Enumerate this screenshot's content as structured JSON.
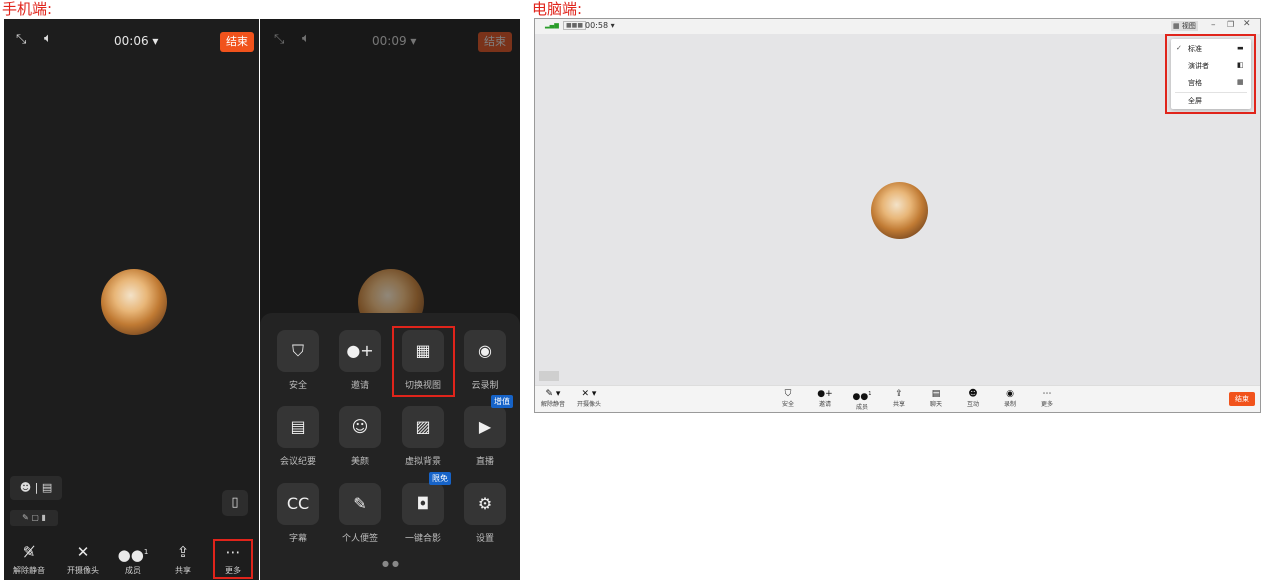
{
  "captions": {
    "phone": "手机端:",
    "desktop": "电脑端:"
  },
  "phone1": {
    "timer": "00:06 ▾",
    "end_label": "结束",
    "bottom_bar": [
      {
        "label": "解除静音",
        "icon": "mic-muted-icon"
      },
      {
        "label": "开摄像头",
        "icon": "camera-off-icon"
      },
      {
        "label": "成员",
        "icon": "members-icon",
        "count": "1"
      },
      {
        "label": "共享",
        "icon": "share-icon"
      },
      {
        "label": "更多",
        "icon": "more-icon"
      }
    ]
  },
  "phone2": {
    "timer": "00:09 ▾",
    "end_label": "结束",
    "more_menu": [
      {
        "label": "安全",
        "icon": "shield-icon"
      },
      {
        "label": "邀请",
        "icon": "invite-icon"
      },
      {
        "label": "切换视图",
        "icon": "switch-view-icon"
      },
      {
        "label": "云录制",
        "icon": "cloud-record-icon"
      },
      {
        "label": "会议纪要",
        "icon": "minutes-icon"
      },
      {
        "label": "美颜",
        "icon": "beauty-icon"
      },
      {
        "label": "虚拟背景",
        "icon": "virtual-bg-icon"
      },
      {
        "label": "直播",
        "icon": "live-icon",
        "badge": "增值"
      },
      {
        "label": "字幕",
        "icon": "caption-icon"
      },
      {
        "label": "个人便签",
        "icon": "note-icon"
      },
      {
        "label": "一键合影",
        "icon": "group-photo-icon",
        "badge": "限免"
      },
      {
        "label": "设置",
        "icon": "settings-icon"
      }
    ]
  },
  "desktop": {
    "timer": "00:58 ▾",
    "view_button": "视图",
    "view_menu": [
      {
        "label": "标准",
        "checked": true
      },
      {
        "label": "演讲者",
        "checked": false
      },
      {
        "label": "宫格",
        "checked": false
      },
      {
        "label": "全屏",
        "checked": false
      }
    ],
    "left_controls": [
      {
        "label": "解除静音",
        "icon": "mic-muted-icon"
      },
      {
        "label": "开摄像头",
        "icon": "camera-off-icon"
      }
    ],
    "toolbar": [
      {
        "label": "安全",
        "icon": "shield-icon"
      },
      {
        "label": "邀请",
        "icon": "invite-icon"
      },
      {
        "label": "成员",
        "icon": "members-icon",
        "count": "1"
      },
      {
        "label": "共享",
        "icon": "share-icon"
      },
      {
        "label": "聊天",
        "icon": "chat-icon"
      },
      {
        "label": "互动",
        "icon": "emoji-icon"
      },
      {
        "label": "录制",
        "icon": "record-icon"
      },
      {
        "label": "更多",
        "icon": "more-icon"
      }
    ],
    "end_label": "结束",
    "colors": {
      "end": "#f1531c",
      "highlight": "#e0241b"
    }
  }
}
